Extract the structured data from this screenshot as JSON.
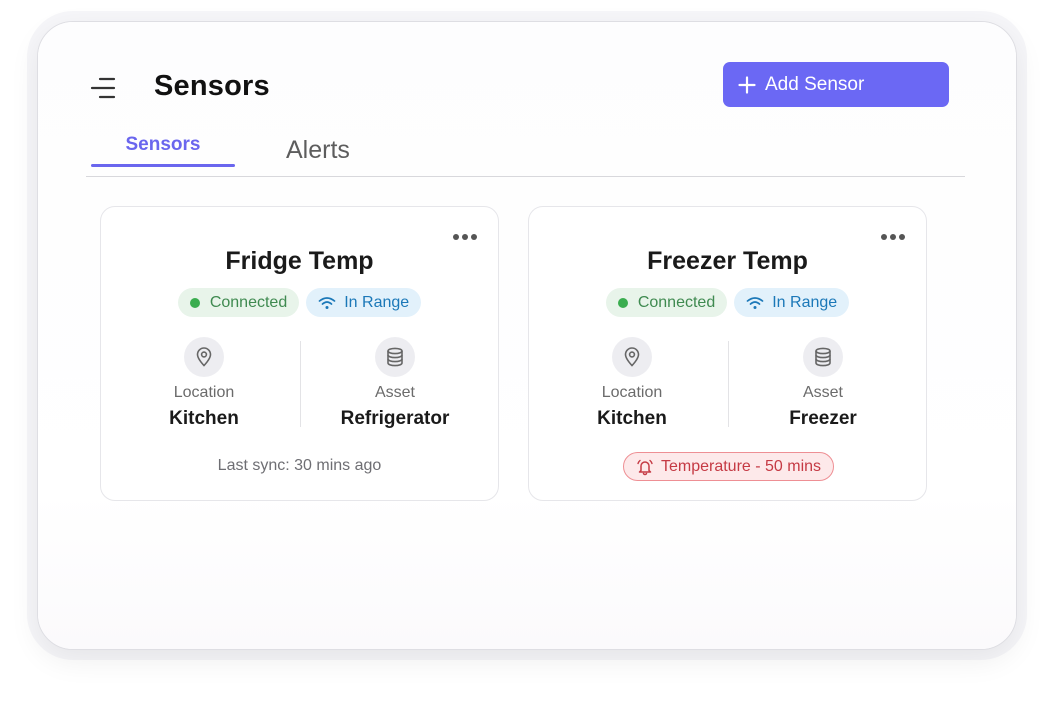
{
  "header": {
    "title": "Sensors",
    "add_button_label": "Add Sensor"
  },
  "tabs": [
    {
      "label": "Sensors",
      "active": true
    },
    {
      "label": "Alerts",
      "active": false
    }
  ],
  "sensors": [
    {
      "name": "Fridge Temp",
      "connection_status": "Connected",
      "range_status": "In Range",
      "location_label": "Location",
      "location": "Kitchen",
      "asset_label": "Asset",
      "asset": "Refrigerator",
      "footer": "Last sync: 30 mins ago"
    },
    {
      "name": "Freezer Temp",
      "connection_status": "Connected",
      "range_status": "In Range",
      "location_label": "Location",
      "location": "Kitchen",
      "asset_label": "Asset",
      "asset": "Freezer",
      "alert": "Temperature - 50 mins"
    }
  ],
  "icons": {
    "menu": "menu-icon",
    "add": "plus-icon",
    "more": "more-horizontal-icon",
    "status_dot": "status-dot-icon",
    "wifi": "wifi-icon",
    "location": "map-pin-icon",
    "asset": "database-icon",
    "alert": "bell-alert-icon"
  },
  "colors": {
    "accent": "#6b68f4",
    "connected_bg": "#e8f4ea",
    "connected_text": "#3f8a50",
    "range_bg": "#e2f1fb",
    "range_text": "#1b78b8",
    "alert_bg": "#fde9ea",
    "alert_border": "#ee8f94",
    "alert_text": "#c53a44"
  }
}
